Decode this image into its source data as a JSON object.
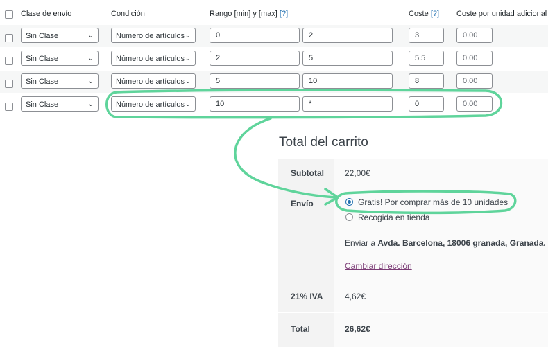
{
  "table": {
    "headers": {
      "shipping_class": "Clase de envío",
      "condition": "Condición",
      "range": "Rango [min] y [max]",
      "range_help": "[?]",
      "cost": "Coste",
      "cost_help": "[?]",
      "cost_per_unit": "Coste por unidad adicional"
    },
    "rows": [
      {
        "class": "Sin Clase",
        "condition": "Número de artículos",
        "min": "0",
        "max": "2",
        "cost": "3",
        "extra": "0.00"
      },
      {
        "class": "Sin Clase",
        "condition": "Número de artículos",
        "min": "2",
        "max": "5",
        "cost": "5.5",
        "extra": "0.00"
      },
      {
        "class": "Sin Clase",
        "condition": "Número de artículos",
        "min": "5",
        "max": "10",
        "cost": "8",
        "extra": "0.00"
      },
      {
        "class": "Sin Clase",
        "condition": "Número de artículos",
        "min": "10",
        "max": "*",
        "cost": "0",
        "extra": "0.00"
      }
    ]
  },
  "cart": {
    "title": "Total del carrito",
    "subtotal_label": "Subtotal",
    "subtotal_value": "22,00€",
    "shipping_label": "Envío",
    "option_free": "Gratis! Por comprar más de 10 unidades",
    "option_pickup": "Recogida en tienda",
    "ship_to_prefix": "Enviar a",
    "ship_to_address": "Avda. Barcelona, 18006 granada, Granada.",
    "change_address": "Cambiar dirección",
    "tax_label": "21% IVA",
    "tax_value": "4,62€",
    "total_label": "Total",
    "total_value": "26,62€"
  },
  "colors": {
    "annotation": "#5fd49b",
    "link": "#7b3b75",
    "accent": "#2271b1"
  }
}
